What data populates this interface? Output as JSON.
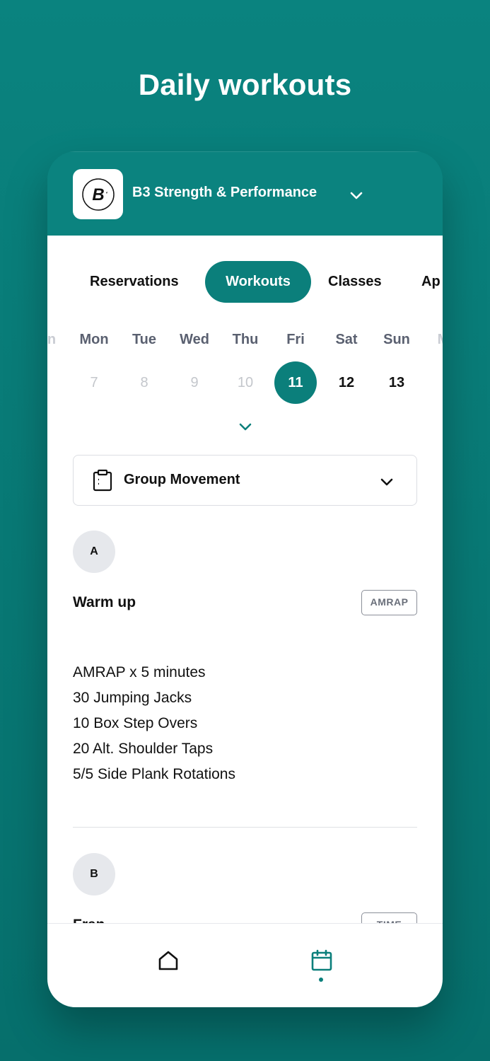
{
  "hero": {
    "title": "Daily workouts"
  },
  "header": {
    "gym_name": "B3 Strength & Performance"
  },
  "tabs": [
    {
      "label": "Reservations",
      "active": false
    },
    {
      "label": "Workouts",
      "active": true
    },
    {
      "label": "Classes",
      "active": false
    },
    {
      "label": "Ap",
      "active": false
    }
  ],
  "week": {
    "days": [
      "n",
      "Mon",
      "Tue",
      "Wed",
      "Thu",
      "Fri",
      "Sat",
      "Sun",
      "M"
    ],
    "dates": [
      "7",
      "8",
      "9",
      "10",
      "11",
      "12",
      "13"
    ],
    "selected": "11"
  },
  "program": {
    "label": "Group Movement"
  },
  "sections": [
    {
      "letter": "A",
      "title": "Warm up",
      "badge": "AMRAP",
      "lines": [
        "AMRAP x 5 minutes",
        "30 Jumping Jacks",
        "10 Box Step Overs",
        "20 Alt. Shoulder Taps",
        "5/5 Side Plank Rotations"
      ]
    },
    {
      "letter": "B",
      "title": "Fran",
      "badge": "TIME"
    }
  ],
  "colors": {
    "brand": "#0b7f7b",
    "background": "#0a837f",
    "muted_text": "#5a6070"
  },
  "icons": {
    "clipboard": "clipboard-icon",
    "chevron": "chevron-down-icon",
    "home": "home-icon",
    "calendar": "calendar-icon"
  }
}
